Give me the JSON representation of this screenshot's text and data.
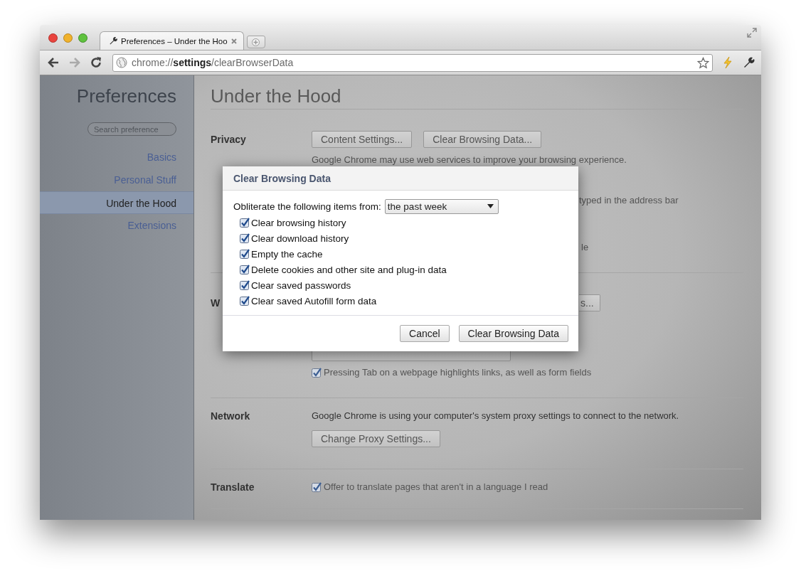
{
  "window": {
    "tab_title": "Preferences – Under the Hoo",
    "address": {
      "scheme": "chrome://",
      "host": "settings",
      "path": "/clearBrowserData"
    }
  },
  "sidebar": {
    "title": "Preferences",
    "search": {
      "placeholder": "Search preference"
    },
    "items": [
      {
        "label": "Basics",
        "selected": false
      },
      {
        "label": "Personal Stuff",
        "selected": false
      },
      {
        "label": "Under the Hood",
        "selected": true
      },
      {
        "label": "Extensions",
        "selected": false
      }
    ]
  },
  "page": {
    "title": "Under the Hood",
    "privacy": {
      "label": "Privacy",
      "buttons": [
        "Content Settings...",
        "Clear Browsing Data..."
      ],
      "description": "Google Chrome may use web services to improve your browsing experience.",
      "fragments": [
        "typed in the address bar",
        "le"
      ]
    },
    "web_content": {
      "label": "W",
      "button_fragment": "s...",
      "option": {
        "label": "Pressing Tab on a webpage highlights links, as well as form fields",
        "checked": true
      }
    },
    "network": {
      "label": "Network",
      "description": "Google Chrome is using your computer's system proxy settings to connect to the network.",
      "button": "Change Proxy Settings..."
    },
    "translate": {
      "label": "Translate",
      "option": {
        "label": "Offer to translate pages that aren't in a language I read",
        "checked": true
      }
    }
  },
  "dialog": {
    "title": "Clear Browsing Data",
    "period_label": "Obliterate the following items from:",
    "period": "the past week",
    "items": [
      {
        "label": "Clear browsing history",
        "checked": true
      },
      {
        "label": "Clear download history",
        "checked": true
      },
      {
        "label": "Empty the cache",
        "checked": true
      },
      {
        "label": "Delete cookies and other site and plug-in data",
        "checked": true
      },
      {
        "label": "Clear saved passwords",
        "checked": true
      },
      {
        "label": "Clear saved Autofill form data",
        "checked": true
      }
    ],
    "buttons": {
      "cancel": "Cancel",
      "confirm": "Clear Browsing Data"
    }
  }
}
